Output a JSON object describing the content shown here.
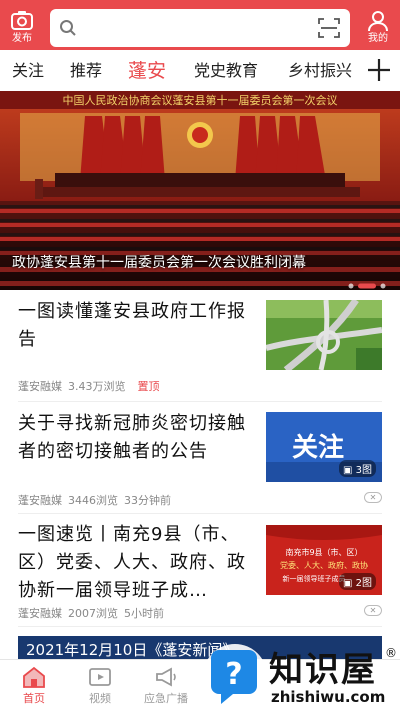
{
  "header": {
    "publish_label": "发布",
    "search_placeholder": "",
    "mine_label": "我的"
  },
  "tabs": [
    "关注",
    "推荐",
    "蓬安",
    "党史教育",
    "乡村振兴"
  ],
  "banner": {
    "top_text": "中国人民政治协商会议蓬安县第十一届委员会第一次会议",
    "caption": "政协蓬安县第十一届委员会第一次会议胜利闭幕"
  },
  "news": [
    {
      "title": "一图读懂蓬安县政府工作报告",
      "source": "蓬安融媒",
      "views": "3.43万浏览",
      "tag": "置顶"
    },
    {
      "title": "关于寻找新冠肺炎密切接触者的密切接触者的公告",
      "source": "蓬安融媒",
      "views": "3446浏览",
      "time": "33分钟前",
      "thumb_text": "关注",
      "img_count": "3图"
    },
    {
      "title": "一图速览丨南充9县（市、区）党委、人大、政府、政协新一届领导班子成…",
      "source": "蓬安融媒",
      "views": "2007浏览",
      "time": "5小时前",
      "thumb_line1": "南充市9县（市、区）",
      "thumb_line2": "党委、人大、政府、政协",
      "thumb_line3": "新一届领导班子成员",
      "img_count": "2图"
    }
  ],
  "blue_bar": "2021年12月10日《蓬安新闻》",
  "bottom_nav": [
    "首页",
    "视频",
    "应急广播"
  ],
  "watermark": {
    "title": "知识屋",
    "url": "zhishiwu.com",
    "reg": "®"
  },
  "colors": {
    "brand": "#e94a4d",
    "banner_dark": "#6b1612",
    "news_bar": "#18386f"
  }
}
